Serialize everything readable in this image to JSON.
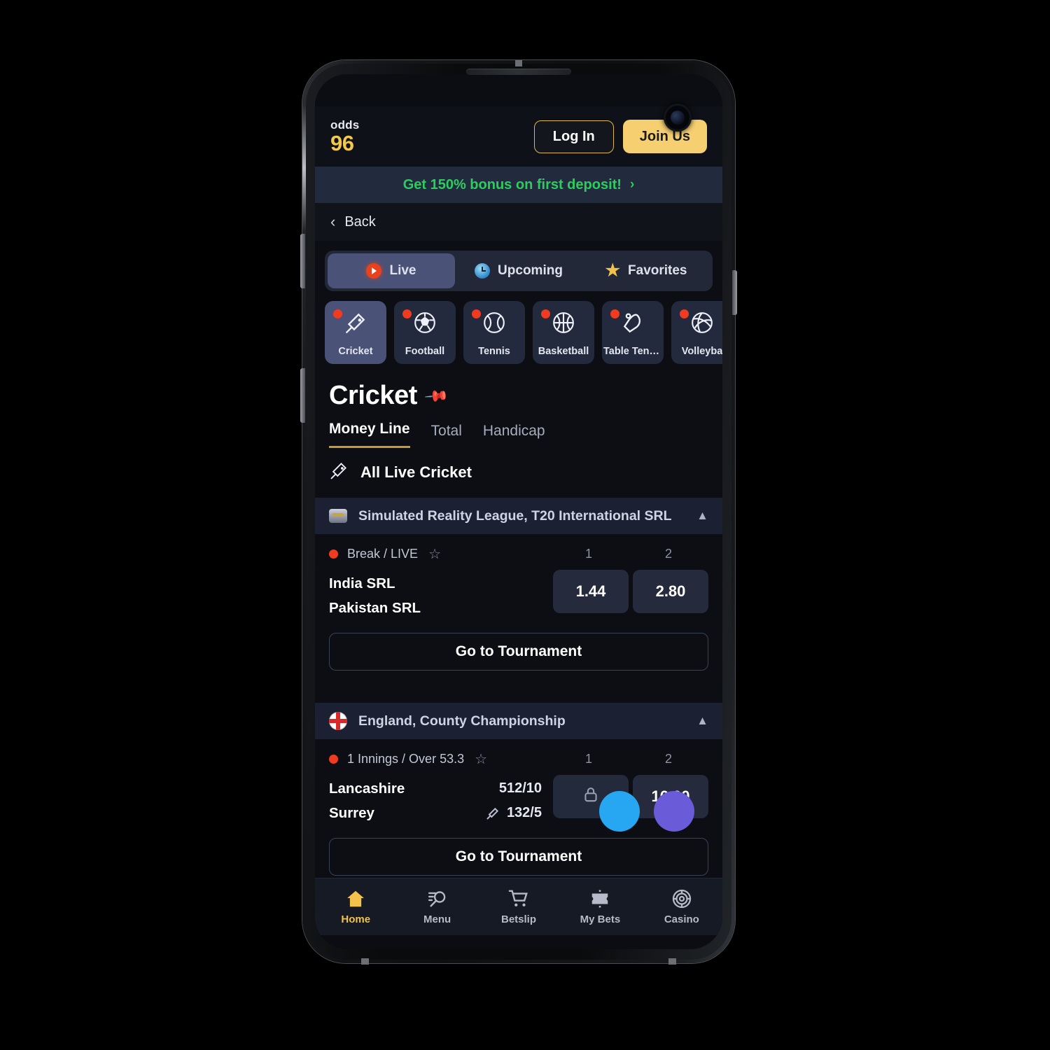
{
  "header": {
    "logo_top": "odds",
    "logo_bottom": "96",
    "login_label": "Log In",
    "join_label": "Join Us"
  },
  "bonus_banner": {
    "text": "Get 150% bonus on first deposit!",
    "chevron": "›",
    "text_color": "#2ecc5f"
  },
  "back_row": {
    "chevron": "‹",
    "label": "Back"
  },
  "segmented_tabs": [
    {
      "label": "Live",
      "icon": "live-play-icon",
      "active": true
    },
    {
      "label": "Upcoming",
      "icon": "clock-icon",
      "active": false
    },
    {
      "label": "Favorites",
      "icon": "star-icon",
      "active": false
    }
  ],
  "sports": [
    {
      "label": "Cricket",
      "icon": "cricket-bat-icon",
      "active": true,
      "live": true
    },
    {
      "label": "Football",
      "icon": "soccer-ball-icon",
      "active": false,
      "live": true
    },
    {
      "label": "Tennis",
      "icon": "tennis-ball-icon",
      "active": false,
      "live": true
    },
    {
      "label": "Basketball",
      "icon": "basketball-icon",
      "active": false,
      "live": true
    },
    {
      "label": "Table Tenn...",
      "icon": "table-tennis-icon",
      "active": false,
      "live": true
    },
    {
      "label": "Volleyba",
      "icon": "volleyball-icon",
      "active": false,
      "live": true
    }
  ],
  "page": {
    "title": "Cricket",
    "pin_icon": "pin-icon"
  },
  "bet_tabs": [
    {
      "label": "Money Line",
      "active": true
    },
    {
      "label": "Total",
      "active": false
    },
    {
      "label": "Handicap",
      "active": false
    }
  ],
  "all_live": {
    "label": "All Live Cricket",
    "icon": "cricket-bat-icon"
  },
  "leagues": [
    {
      "name": "Simulated Reality League, T20 International SRL",
      "icon": "srl-badge-icon",
      "collapse_icon": "chevron-up-icon",
      "match": {
        "status": "Break / LIVE",
        "favorite_icon": "star-outline-icon",
        "columns": [
          "1",
          "2"
        ],
        "teams": [
          {
            "name": "India SRL",
            "score": "",
            "batting": false
          },
          {
            "name": "Pakistan SRL",
            "score": "",
            "batting": false
          }
        ],
        "odds": [
          {
            "value": "1.44",
            "locked": false
          },
          {
            "value": "2.80",
            "locked": false
          }
        ]
      },
      "go_to_tournament": "Go to Tournament"
    },
    {
      "name": "England, County Championship",
      "icon": "england-flag-icon",
      "collapse_icon": "chevron-up-icon",
      "match": {
        "status": "1 Innings / Over 53.3",
        "favorite_icon": "star-outline-icon",
        "columns": [
          "1",
          "2"
        ],
        "teams": [
          {
            "name": "Lancashire",
            "score": "512/10",
            "batting": false
          },
          {
            "name": "Surrey",
            "score": "132/5",
            "batting": true
          }
        ],
        "odds": [
          {
            "value": "",
            "locked": true,
            "lock_icon": "lock-icon"
          },
          {
            "value": "16.00",
            "locked": false
          }
        ]
      },
      "go_to_tournament": "Go to Tournament"
    }
  ],
  "bottom_nav": [
    {
      "label": "Home",
      "icon": "home-icon",
      "active": true
    },
    {
      "label": "Menu",
      "icon": "search-menu-icon",
      "active": false
    },
    {
      "label": "Betslip",
      "icon": "cart-icon",
      "active": false
    },
    {
      "label": "My Bets",
      "icon": "ticket-icon",
      "active": false
    },
    {
      "label": "Casino",
      "icon": "casino-chip-icon",
      "active": false
    }
  ],
  "colors": {
    "accent_yellow": "#f2c24a",
    "brand_green": "#2ecc5f",
    "live_red": "#f03b20",
    "panel": "#232a3d",
    "panel_active": "#4a5278",
    "background": "#0c0e14"
  }
}
